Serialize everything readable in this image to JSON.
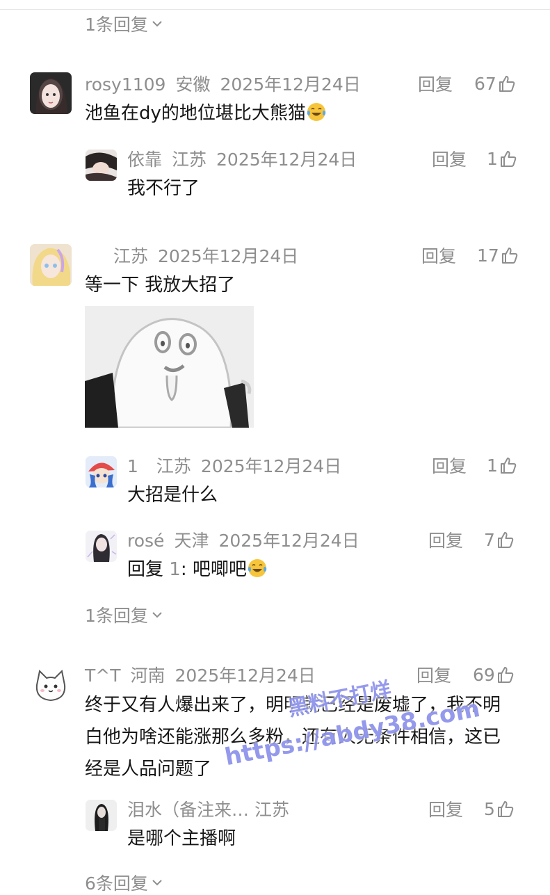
{
  "top_more": "1条回复",
  "reply_label": "回复",
  "comments": [
    {
      "user": "rosy1109",
      "location": "安徽",
      "date": "2025年12月24日",
      "likes": "67",
      "text": "池鱼在dy的地位堪比大熊猫"
    },
    {
      "user": "依靠",
      "location": "江苏",
      "date": "2025年12月24日",
      "likes": "1",
      "text": "我不行了"
    },
    {
      "user": "",
      "location": "江苏",
      "date": "2025年12月24日",
      "likes": "17",
      "text": "等一下 我放大招了"
    },
    {
      "user": "1",
      "location": "江苏",
      "date": "2025年12月24日",
      "likes": "1",
      "text": "大招是什么"
    },
    {
      "user": "rosé",
      "location": "天津",
      "date": "2025年12月24日",
      "likes": "7",
      "reply_prefix": "回复 ",
      "reply_to": "1",
      "text": ": 吧唧吧"
    },
    {
      "user": "T^T",
      "location": "河南",
      "date": "2025年12月24日",
      "likes": "69",
      "text": "终于又有人爆出来了，明明就已经是废墟了，我不明白他为啥还能涨那么多粉，还有人无条件相信，这已经是人品问题了"
    },
    {
      "user": "泪水（备注来…",
      "location": "江苏",
      "date": "",
      "likes": "5",
      "text": "是哪个主播啊"
    }
  ],
  "more_1": "1条回复",
  "more_2": "6条回复",
  "watermark": {
    "line1": "黑料不打烊",
    "line2": "https://abdy38.com"
  },
  "icons": {
    "thumb": "thumbs-up-icon",
    "chevron": "chevron-down-icon",
    "emoji": "tears-of-joy-emoji-icon"
  },
  "colors": {
    "meta": "#8e8e8e",
    "text": "#161616",
    "watermark": "#3c46dc"
  }
}
